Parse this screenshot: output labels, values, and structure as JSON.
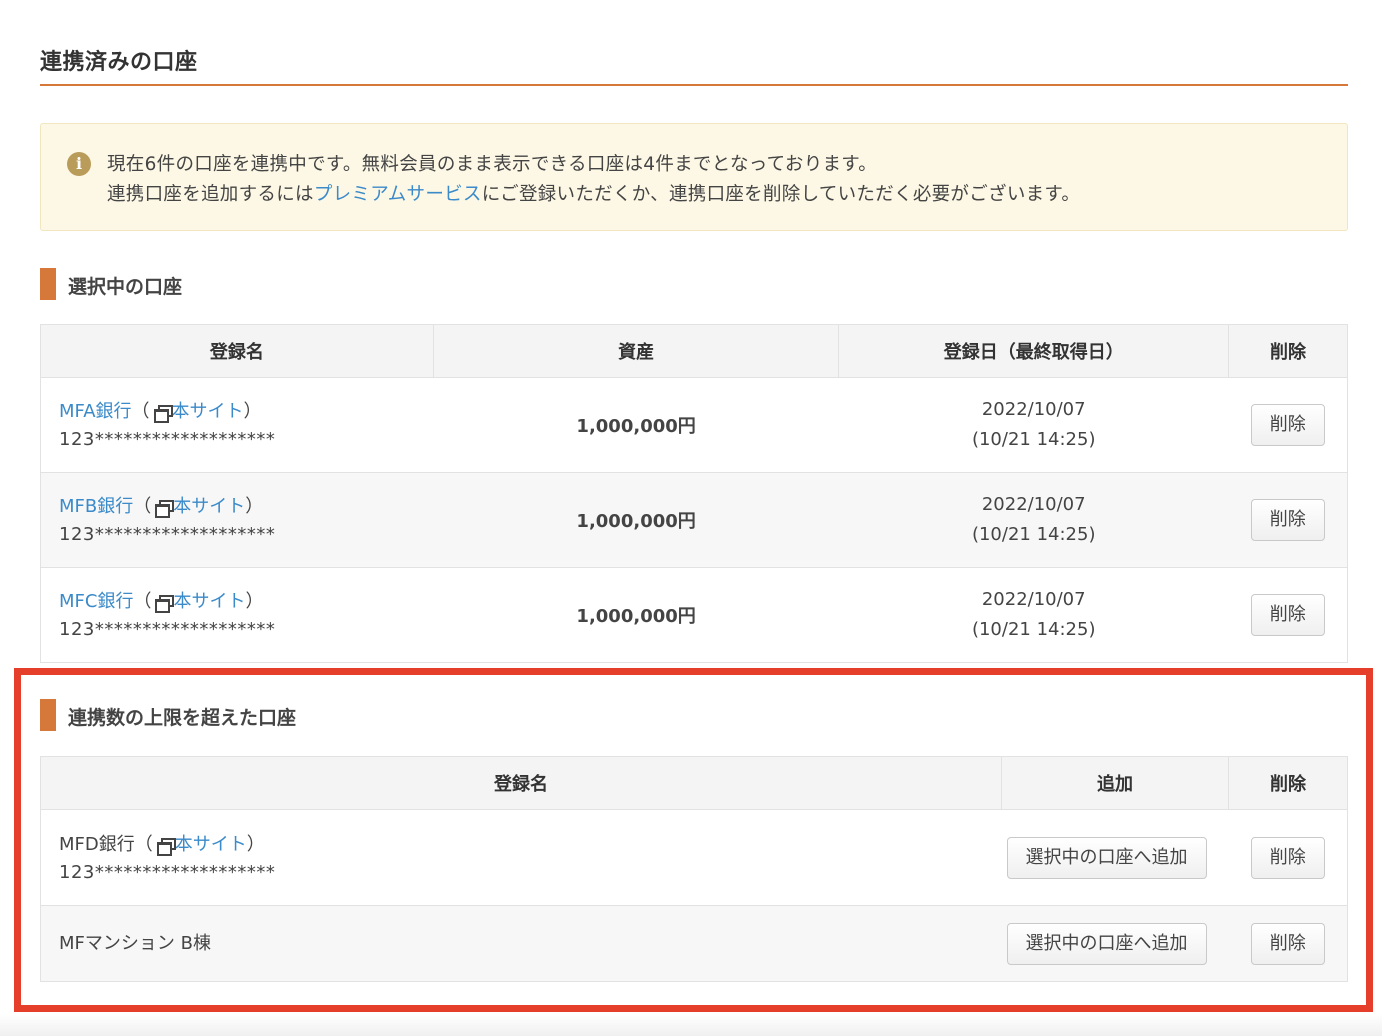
{
  "page_title": "連携済みの口座",
  "notice": {
    "icon": "info-icon",
    "line1": "現在6件の口座を連携中です。無料会員のまま表示できる口座は4件までとなっております。",
    "line2_before": "連携口座を追加するには",
    "line2_link": "プレミアムサービス",
    "line2_after": "にご登録いただくか、連携口座を削除していただく必要がございます。"
  },
  "selected": {
    "heading": "選択中の口座",
    "columns": {
      "name": "登録名",
      "asset": "資産",
      "date": "登録日（最終取得日）",
      "delete": "削除"
    },
    "rows": [
      {
        "bank": "MFA銀行",
        "open_paren": "（",
        "site": "本サイト",
        "close_paren": "）",
        "number": "123*******************",
        "asset": "1,000,000円",
        "date": "2022/10/07",
        "last": "(10/21 14:25)",
        "delete": "削除"
      },
      {
        "bank": "MFB銀行",
        "open_paren": "（",
        "site": "本サイト",
        "close_paren": "）",
        "number": "123*******************",
        "asset": "1,000,000円",
        "date": "2022/10/07",
        "last": "(10/21 14:25)",
        "delete": "削除"
      },
      {
        "bank": "MFC銀行",
        "open_paren": "（",
        "site": "本サイト",
        "close_paren": "）",
        "number": "123*******************",
        "asset": "1,000,000円",
        "date": "2022/10/07",
        "last": "(10/21 14:25)",
        "delete": "削除"
      }
    ]
  },
  "over_limit": {
    "heading": "連携数の上限を超えた口座",
    "columns": {
      "name": "登録名",
      "add": "追加",
      "delete": "削除"
    },
    "rows": [
      {
        "bank": "MFD銀行",
        "open_paren": "（",
        "site": "本サイト",
        "close_paren": "）",
        "number": "123*******************",
        "add": "選択中の口座へ追加",
        "delete": "削除"
      },
      {
        "name": "MFマンション B棟",
        "add": "選択中の口座へ追加",
        "delete": "削除"
      }
    ]
  },
  "colors": {
    "accent": "#d6783a",
    "link": "#3b8ac9",
    "highlight": "#e53e2a",
    "notice_bg": "#fdf8e5"
  }
}
